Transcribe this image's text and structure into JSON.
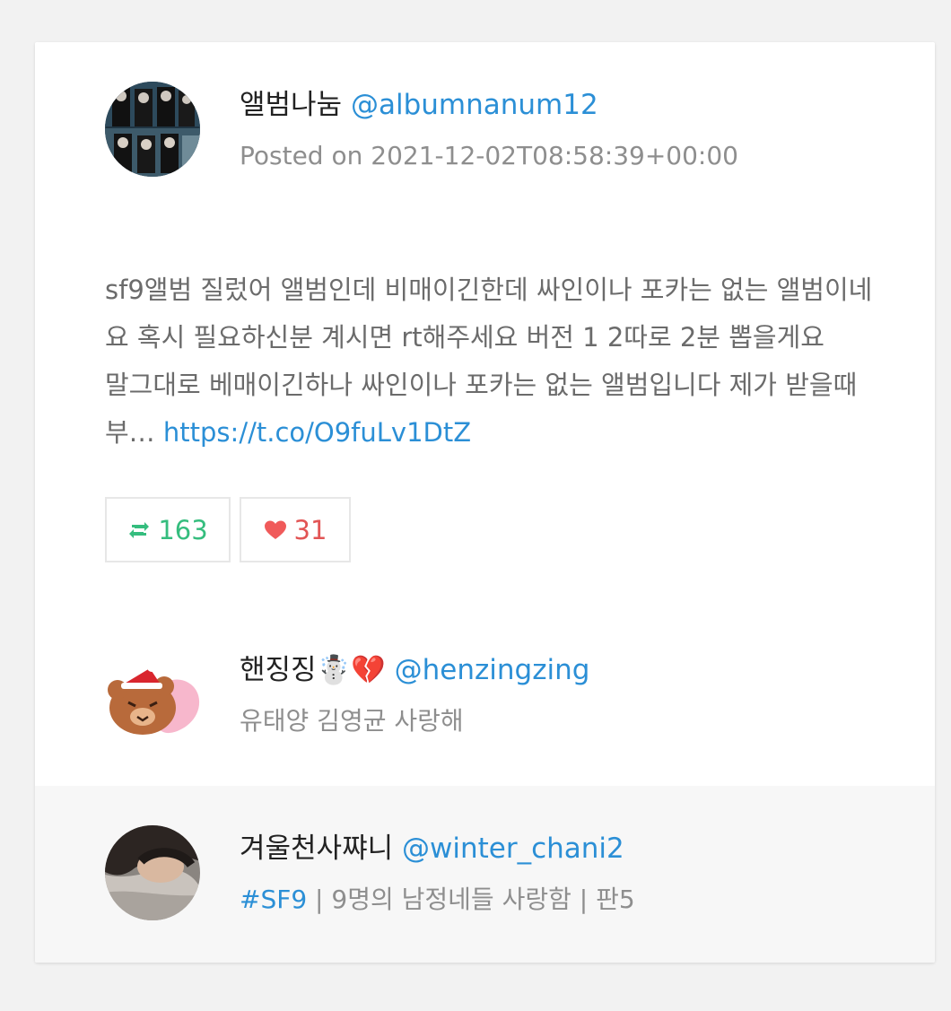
{
  "post": {
    "author_name": "앨범나눔",
    "author_handle": "@albumnanum12",
    "posted_on": "Posted on 2021-12-02T08:58:39+00:00",
    "text_line1": "sf9앨범 질렀어 앨범인데 비매이긴한데 싸인이나 포카는 없는 앨범이네요 혹시 필요하신분 계시면 rt해주세요 버전 1 2따로 2분 뽑을게요",
    "text_line2": "말그대로 베매이긴하나 싸인이나 포카는 없는 앨범입니다 제가 받을때부…",
    "link": "https://t.co/O9fuLv1DtZ",
    "retweet_count": "163",
    "like_count": "31"
  },
  "user1": {
    "name": "핸징징☃️💔",
    "handle": "@henzingzing",
    "bio": "유태양 김영균 사랑해"
  },
  "user2": {
    "name": "겨울천사쨔니",
    "handle": "@winter_chani2",
    "hashtag": "#SF9",
    "bio_rest": " | 9명의 남정네들 사랑함 | 판5"
  },
  "colors": {
    "link": "#2b8fd6",
    "retweet": "#35bd7e",
    "like": "#e25555",
    "background": "#f2f2f2",
    "card": "#ffffff",
    "footer": "#f7f7f7"
  },
  "icons": [
    "retweet-icon",
    "heart-icon"
  ]
}
